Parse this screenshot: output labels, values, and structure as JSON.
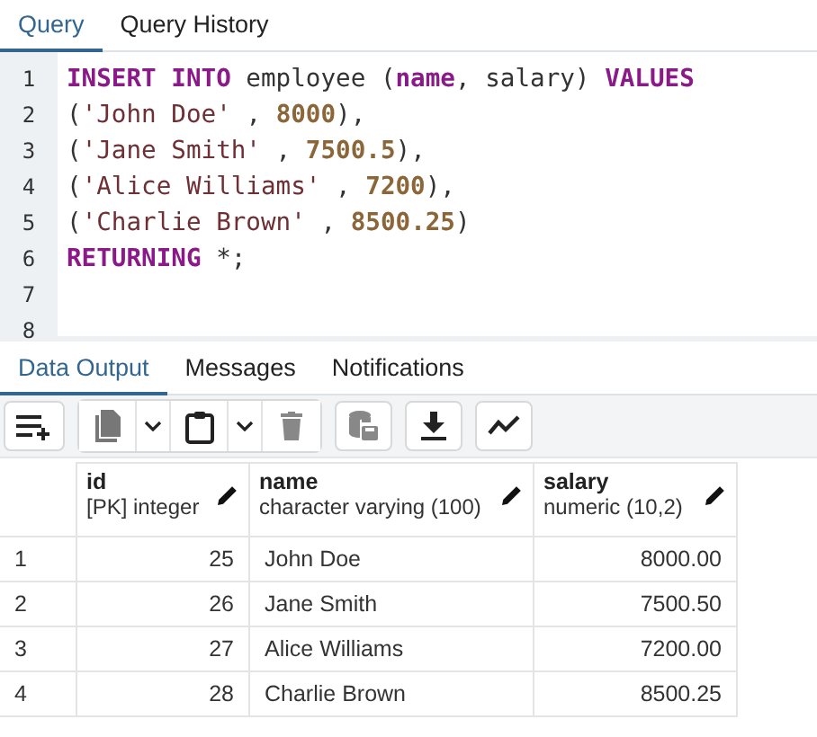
{
  "editor_tabs": [
    {
      "label": "Query",
      "selected": true
    },
    {
      "label": "Query History",
      "selected": false
    }
  ],
  "code_lines": [
    {
      "number": "1",
      "tokens": [
        {
          "kind": "keyword",
          "text": "INSERT INTO"
        },
        {
          "kind": "plain",
          "text": " employee ("
        },
        {
          "kind": "keyword",
          "text": "name"
        },
        {
          "kind": "plain",
          "text": ", salary) "
        },
        {
          "kind": "keyword",
          "text": "VALUES"
        }
      ]
    },
    {
      "number": "2",
      "tokens": [
        {
          "kind": "plain",
          "text": "("
        },
        {
          "kind": "string",
          "text": "'John Doe'"
        },
        {
          "kind": "plain",
          "text": " , "
        },
        {
          "kind": "number",
          "text": "8000"
        },
        {
          "kind": "plain",
          "text": "),"
        }
      ]
    },
    {
      "number": "3",
      "tokens": [
        {
          "kind": "plain",
          "text": "("
        },
        {
          "kind": "string",
          "text": "'Jane Smith'"
        },
        {
          "kind": "plain",
          "text": " , "
        },
        {
          "kind": "number",
          "text": "7500.5"
        },
        {
          "kind": "plain",
          "text": "),"
        }
      ]
    },
    {
      "number": "4",
      "tokens": [
        {
          "kind": "plain",
          "text": "("
        },
        {
          "kind": "string",
          "text": "'Alice Williams'"
        },
        {
          "kind": "plain",
          "text": " , "
        },
        {
          "kind": "number",
          "text": "7200"
        },
        {
          "kind": "plain",
          "text": "),"
        }
      ]
    },
    {
      "number": "5",
      "tokens": [
        {
          "kind": "plain",
          "text": "("
        },
        {
          "kind": "string",
          "text": "'Charlie Brown'"
        },
        {
          "kind": "plain",
          "text": " , "
        },
        {
          "kind": "number",
          "text": "8500.25"
        },
        {
          "kind": "plain",
          "text": ")"
        }
      ]
    },
    {
      "number": "6",
      "tokens": [
        {
          "kind": "keyword",
          "text": "RETURNING"
        },
        {
          "kind": "plain",
          "text": " *;"
        }
      ]
    },
    {
      "number": "7"
    },
    {
      "number": "8"
    }
  ],
  "result_tabs": [
    {
      "label": "Data Output",
      "selected": true
    },
    {
      "label": "Messages",
      "selected": false
    },
    {
      "label": "Notifications",
      "selected": false
    }
  ],
  "table": {
    "columns": [
      {
        "name": "id",
        "type": "[PK] integer",
        "kind": "number"
      },
      {
        "name": "name",
        "type": "character varying (100)",
        "kind": "text"
      },
      {
        "name": "salary",
        "type": "numeric (10,2)",
        "kind": "number"
      }
    ],
    "rows": [
      {
        "number": "1",
        "cells": [
          "25",
          "John Doe",
          "8000.00"
        ]
      },
      {
        "number": "2",
        "cells": [
          "26",
          "Jane Smith",
          "7500.50"
        ]
      },
      {
        "number": "3",
        "cells": [
          "27",
          "Alice Williams",
          "7200.00"
        ]
      },
      {
        "number": "4",
        "cells": [
          "28",
          "Charlie Brown",
          "8500.25"
        ]
      }
    ]
  }
}
